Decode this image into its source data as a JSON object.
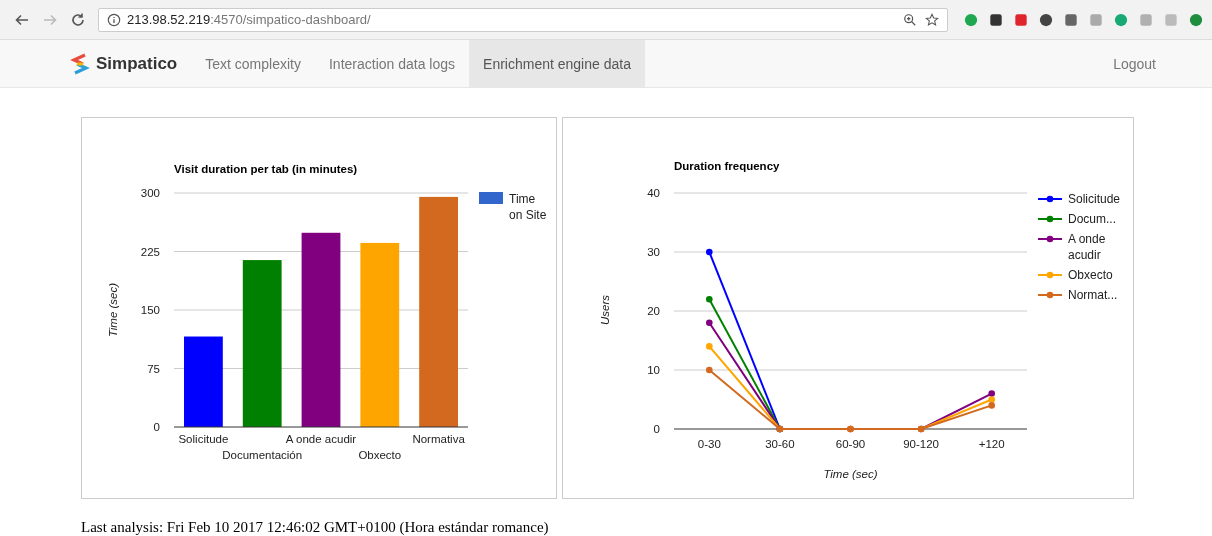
{
  "browser": {
    "address_host": "213.98.52.219",
    "address_path": ":4570/simpatico-dashboard/"
  },
  "nav": {
    "brand": "Simpatico",
    "tabs": [
      {
        "label": "Text complexity",
        "selected": false
      },
      {
        "label": "Interaction data logs",
        "selected": false
      },
      {
        "label": "Enrichment engine data",
        "selected": true
      }
    ],
    "logout": "Logout"
  },
  "bar_chart": {
    "chart_data": {
      "type": "bar",
      "title": "Visit duration per tab (in minutes)",
      "ylabel": "Time (sec)",
      "categories": [
        "Solicitude",
        "Documentación",
        "A onde acudir",
        "Obxecto",
        "Normativa"
      ],
      "series": [
        {
          "name": "Time on Site",
          "values": [
            116,
            214,
            249,
            236,
            295
          ]
        }
      ],
      "ylim": [
        0,
        300
      ],
      "yticks": [
        0,
        75,
        150,
        225,
        300
      ],
      "grid": true
    },
    "legend_swatch": {
      "color": "#3366cc"
    },
    "bars": [
      {
        "color": "#0000ff"
      },
      {
        "color": "#008000"
      },
      {
        "color": "#800080"
      },
      {
        "color": "#ffa500"
      },
      {
        "color": "#d2691e"
      }
    ]
  },
  "line_chart": {
    "chart_data": {
      "type": "line",
      "title": "Duration frequency",
      "xlabel": "Time (sec)",
      "ylabel": "Users",
      "categories": [
        "0-30",
        "30-60",
        "60-90",
        "90-120",
        "+120"
      ],
      "series": [
        {
          "name": "Solicitude",
          "color": "#0000ff",
          "marker": true,
          "values": [
            30,
            0,
            null,
            null,
            null
          ]
        },
        {
          "name": "Docum...",
          "color": "#008000",
          "marker": true,
          "values": [
            22,
            0,
            null,
            null,
            null
          ]
        },
        {
          "name": "A onde acudir",
          "color": "#800080",
          "marker": true,
          "values": [
            18,
            0,
            0,
            0,
            6
          ]
        },
        {
          "name": "Obxecto",
          "color": "#ffa500",
          "marker": true,
          "values": [
            14,
            0,
            0,
            0,
            5
          ]
        },
        {
          "name": "Normat...",
          "color": "#d2691e",
          "marker": true,
          "values": [
            10,
            0,
            0,
            0,
            4
          ]
        }
      ],
      "ylim": [
        0,
        40
      ],
      "yticks": [
        0,
        10,
        20,
        30,
        40
      ],
      "grid": true
    }
  },
  "footer": "Last analysis: Fri Feb 10 2017 12:46:02 GMT+0100 (Hora estándar romance)"
}
